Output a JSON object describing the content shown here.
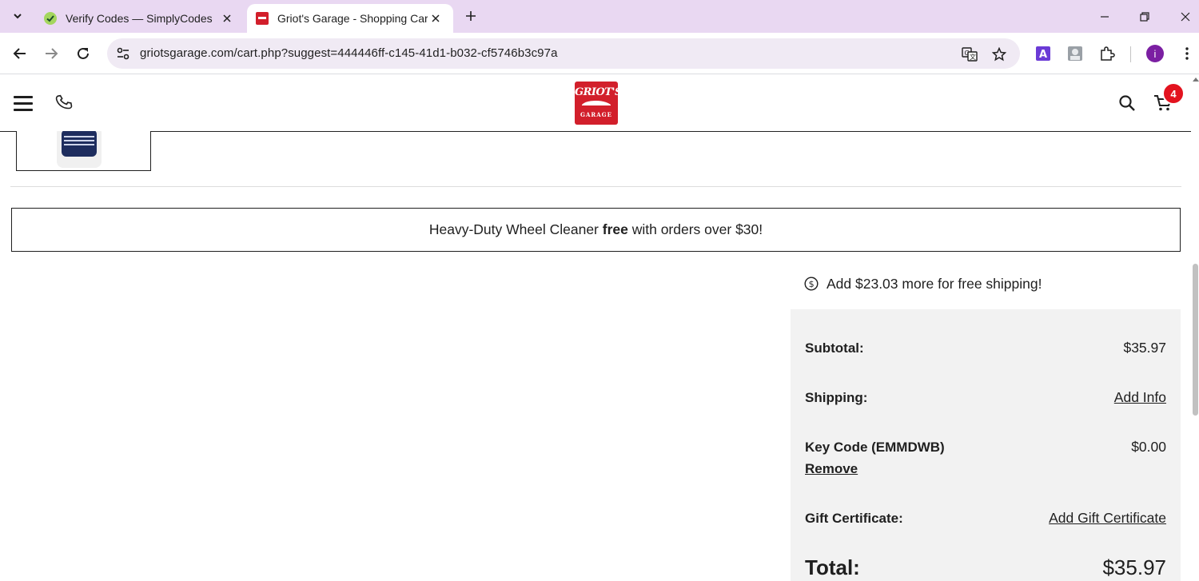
{
  "browser": {
    "tabs": [
      {
        "title": "Verify Codes — SimplyCodes",
        "active": false,
        "favicon": "simplycodes-icon"
      },
      {
        "title": "Griot's Garage - Shopping Cart",
        "active": true,
        "favicon": "griots-favicon"
      }
    ],
    "url": "griotsgarage.com/cart.php?suggest=444446ff-c145-41d1-b032-cf5746b3c97a",
    "profile_initial": "i",
    "accent": "#e9d8f2"
  },
  "site": {
    "logo_top": "GRIOT'S",
    "logo_bottom": "GARAGE",
    "cart_count": "4",
    "brand_color": "#d21f2b"
  },
  "promo": {
    "prefix": "Heavy-Duty Wheel Cleaner ",
    "bold": "free",
    "suffix": " with orders over $30!"
  },
  "free_shipping": {
    "text": "Add $23.03 more for free shipping!"
  },
  "summary": {
    "subtotal_label": "Subtotal:",
    "subtotal_value": "$35.97",
    "shipping_label": "Shipping:",
    "shipping_value": "Add Info",
    "keycode_label": "Key Code (EMMDWB)",
    "keycode_value": "$0.00",
    "keycode_remove": "Remove",
    "gift_label": "Gift Certificate:",
    "gift_value": "Add Gift Certificate",
    "total_label": "Total:",
    "total_value": "$35.97"
  }
}
